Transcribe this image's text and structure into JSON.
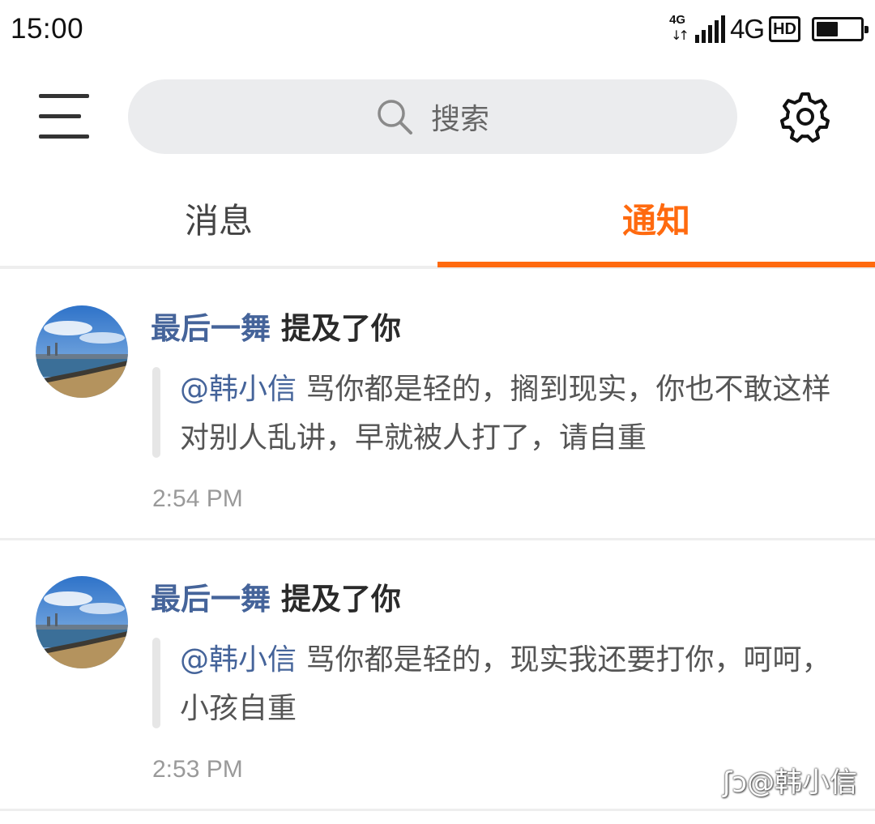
{
  "status_bar": {
    "time": "15:00",
    "network_small": "4G",
    "network": "4G",
    "hd": "HD",
    "battery_level": 0.5,
    "icons": [
      "data-arrows-icon",
      "signal-icon",
      "battery-icon"
    ]
  },
  "header": {
    "menu_icon": "menu-icon",
    "search_placeholder": "搜索",
    "search_icon": "search-icon",
    "settings_icon": "gear-icon"
  },
  "tabs": [
    {
      "label": "消息",
      "active": false
    },
    {
      "label": "通知",
      "active": true
    }
  ],
  "colors": {
    "accent": "#ff6a0f",
    "username": "#45649a",
    "search_bg": "#ebecee"
  },
  "notifications": [
    {
      "user": "最后一舞",
      "action": "提及了你",
      "mention": "@韩小信",
      "text": "骂你都是轻的，搁到现实，你也不敢这样对别人乱讲，早就被人打了，请自重",
      "time": "2:54 PM"
    },
    {
      "user": "最后一舞",
      "action": "提及了你",
      "mention": "@韩小信",
      "text": "骂你都是轻的，现实我还要打你，呵呵，小孩自重",
      "time": "2:53 PM"
    }
  ],
  "watermark": "@韩小信"
}
